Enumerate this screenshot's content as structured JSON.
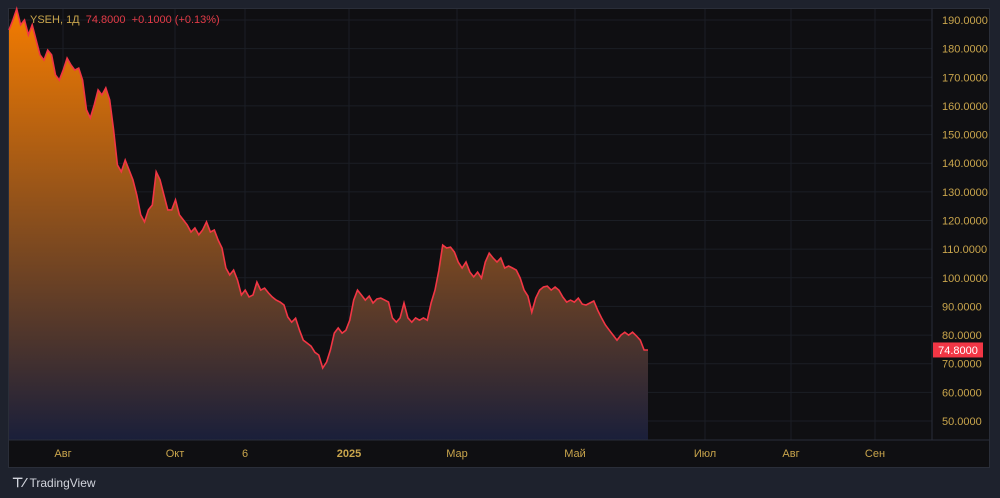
{
  "legend": {
    "symbol": "YSEH, 1Д",
    "price": "74.8000",
    "change": "+0.1000 (+0.13%)"
  },
  "brand": "TradingView",
  "colors": {
    "line": "#f23645",
    "fill_top": "#f57c00",
    "fill_bottom": "#1a1f3a",
    "axis_text": "#c9a54c",
    "last_label": "#f23645"
  },
  "chart_data": {
    "type": "area",
    "title": "YSEH, 1Д",
    "ylim": [
      50,
      190
    ],
    "y_ticks": [
      "190.0000",
      "180.0000",
      "170.0000",
      "160.0000",
      "150.0000",
      "140.0000",
      "130.0000",
      "120.0000",
      "110.0000",
      "100.0000",
      "90.0000",
      "80.0000",
      "70.0000",
      "60.0000",
      "50.0000"
    ],
    "x_ticks": [
      "Авг",
      "Окт",
      "6",
      "2025",
      "Мар",
      "Май",
      "Июл",
      "Авг",
      "Сен"
    ],
    "last_value_label": "74.8000",
    "grid": true,
    "values": [
      186.5,
      190,
      194.2,
      188.3,
      190,
      184.8,
      188.3,
      183,
      177.8,
      176,
      179.5,
      177.8,
      170.8,
      169,
      172.5,
      176.7,
      174.3,
      172.5,
      173.2,
      169,
      158.6,
      155.8,
      160.3,
      165.6,
      163.8,
      166.3,
      162.1,
      151.6,
      139.4,
      137,
      141.1,
      137.6,
      134.2,
      128.9,
      122,
      119.5,
      123.7,
      125.4,
      137,
      134.2,
      128.9,
      123.7,
      123.7,
      127.2,
      122,
      120.2,
      118.5,
      116,
      117.4,
      115,
      116.7,
      119.5,
      116,
      116.7,
      113.2,
      110.4,
      103.4,
      101,
      102.7,
      99.2,
      94,
      95.7,
      93.3,
      94,
      98.5,
      95.7,
      96.4,
      94.7,
      93.3,
      92.2,
      91.5,
      90.5,
      86.3,
      84.5,
      85.9,
      81.7,
      78.2,
      77.2,
      76.1,
      74,
      73,
      68.5,
      70.6,
      74.8,
      80.7,
      82.5,
      80.7,
      81.7,
      85.2,
      92.2,
      95.7,
      94,
      92.2,
      93.6,
      91.2,
      92.6,
      92.9,
      92.2,
      91.5,
      86,
      84.5,
      86,
      91.2,
      86,
      84.5,
      86,
      85.2,
      86,
      85.2,
      91.2,
      95.7,
      102.7,
      111.4,
      110.4,
      110.7,
      109,
      105.5,
      103.4,
      105.5,
      102,
      100.3,
      102,
      99.9,
      105.5,
      108.6,
      106.9,
      105.5,
      106.9,
      103.4,
      104.1,
      103.4,
      102.7,
      99.9,
      95.7,
      93.6,
      88,
      92.9,
      95.7,
      96.8,
      97.1,
      95.7,
      96.8,
      95.7,
      93.3,
      91.5,
      92.2,
      91.5,
      92.9,
      90.8,
      90.5,
      91.2,
      91.9,
      88.7,
      86,
      83.5,
      81.7,
      80,
      78.2,
      80,
      81,
      80,
      81,
      79.7,
      78.2,
      74.8,
      74.8
    ]
  }
}
